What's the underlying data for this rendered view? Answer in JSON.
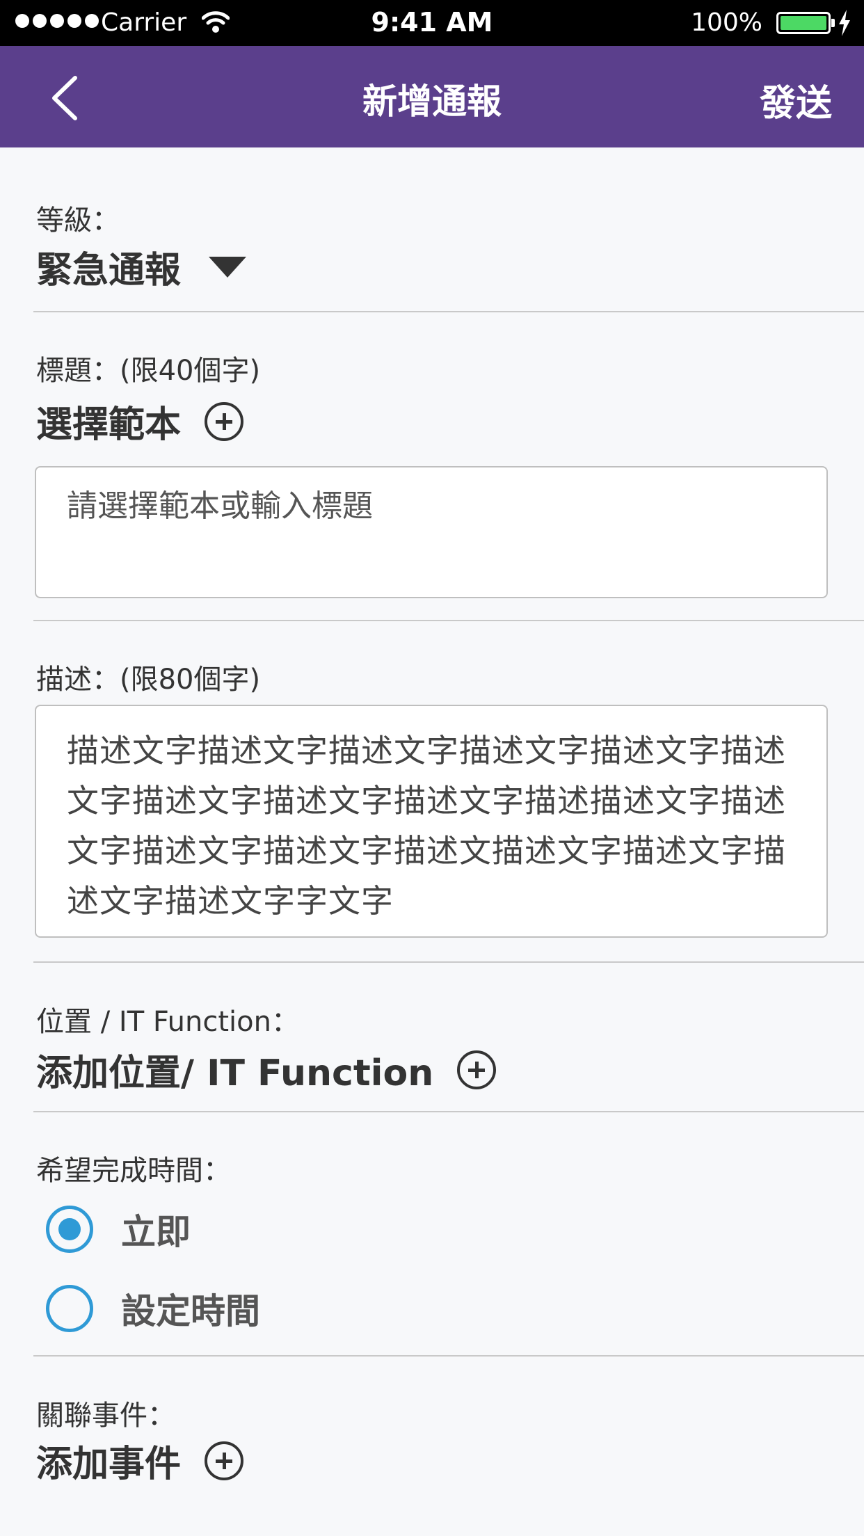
{
  "status_bar": {
    "carrier": "Carrier",
    "time": "9:41 AM",
    "battery": "100%"
  },
  "nav": {
    "title": "新增通報",
    "send_label": "發送"
  },
  "level": {
    "label": "等級：",
    "value": "緊急通報"
  },
  "title_section": {
    "label": "標題：(限40個字)",
    "template_label": "選擇範本",
    "placeholder": "請選擇範本或輸入標題"
  },
  "description": {
    "label": "描述：(限80個字)",
    "text": "描述文字描述文字描述文字描述文字描述文字描述文字描述文字描述文字描述文字描述描述文字描述文字描述文字描述文字描述文描述文字描述文字描述文字描述文字字文字"
  },
  "location": {
    "label": "位置 / IT Function：",
    "add_label": "添加位置/ IT Function"
  },
  "completion": {
    "label": "希望完成時間：",
    "options": [
      {
        "label": "立即",
        "checked": true
      },
      {
        "label": "設定時間",
        "checked": false
      }
    ]
  },
  "related": {
    "label": "關聯事件：",
    "add_label": "添加事件"
  },
  "colors": {
    "nav_bg": "#5b3f8c",
    "accent": "#2f9ad6"
  }
}
